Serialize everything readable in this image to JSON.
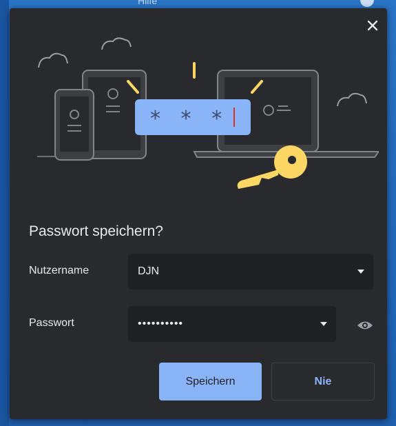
{
  "window": {
    "backdrop_title": "Hilfe"
  },
  "dialog": {
    "title": "Passwort speichern?",
    "close_icon": "close-icon",
    "illustration": {
      "masked_text": "* * *"
    },
    "username": {
      "label": "Nutzername",
      "value": "DJN"
    },
    "password": {
      "label": "Passwort",
      "value": "••••••••••"
    },
    "buttons": {
      "save": "Speichern",
      "never": "Nie"
    }
  },
  "colors": {
    "dialog_bg": "#292a2d",
    "field_bg": "#202124",
    "accent": "#8ab4f8",
    "key_yellow": "#fdd663"
  }
}
